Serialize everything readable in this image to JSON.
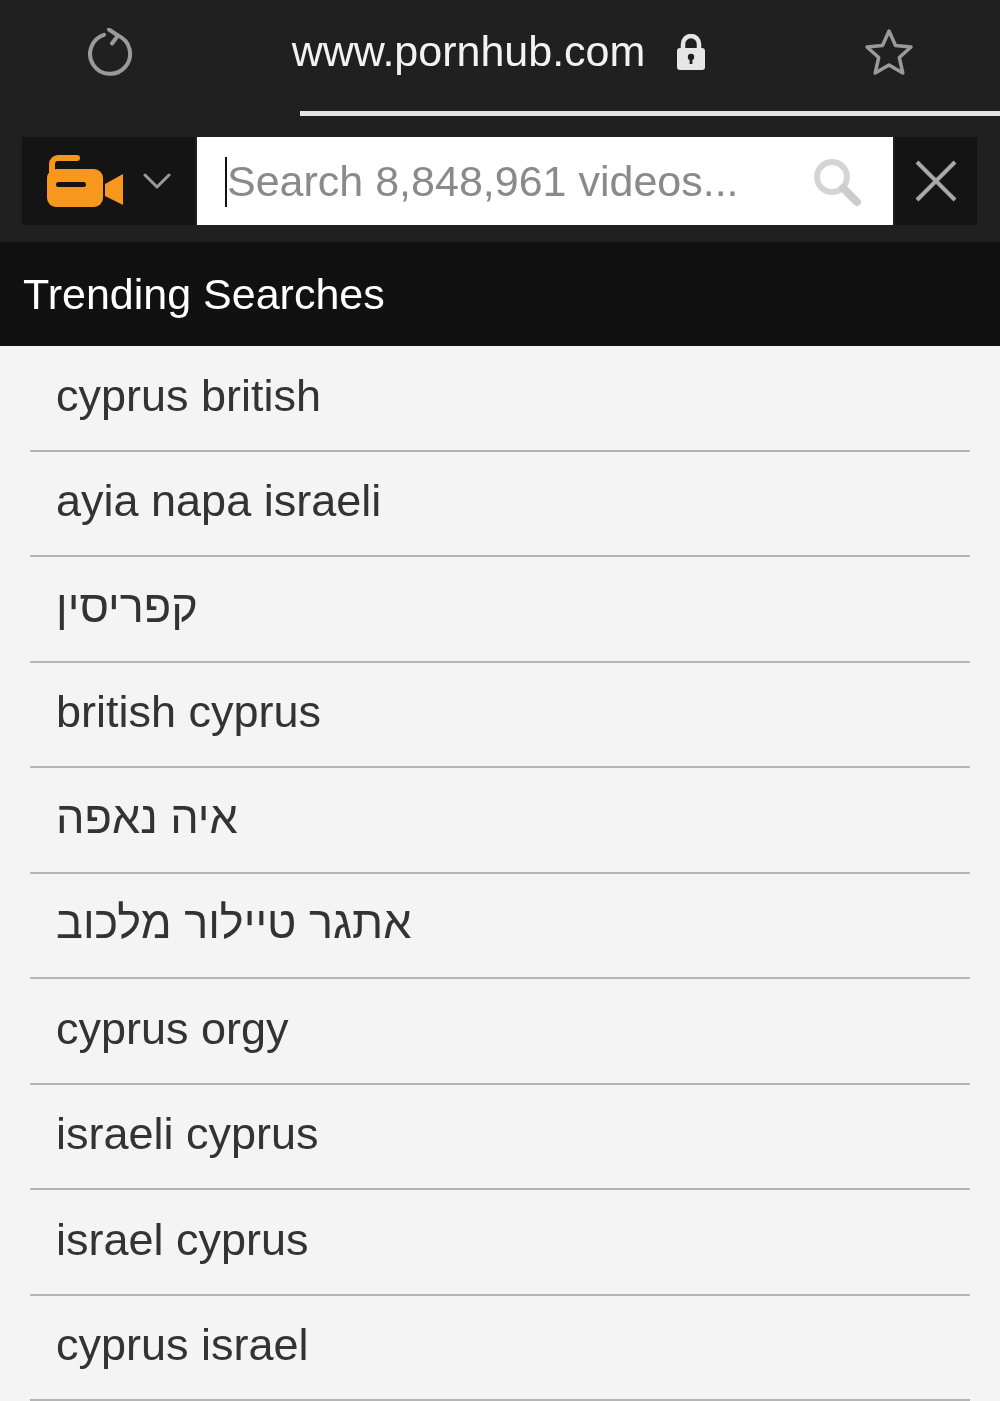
{
  "browser_bar": {
    "url": "www.pornhub.com",
    "secure": true
  },
  "search_bar": {
    "placeholder": "Search 8,848,961 videos..."
  },
  "trending": {
    "title": "Trending Searches",
    "items": [
      "cyprus british",
      "ayia napa israeli",
      "קפריסין",
      "british cyprus",
      "איה נאפה",
      "אתגר טיילור מלכוב",
      "cyprus orgy",
      "israeli cyprus",
      "israel cyprus",
      "cyprus israel"
    ]
  }
}
